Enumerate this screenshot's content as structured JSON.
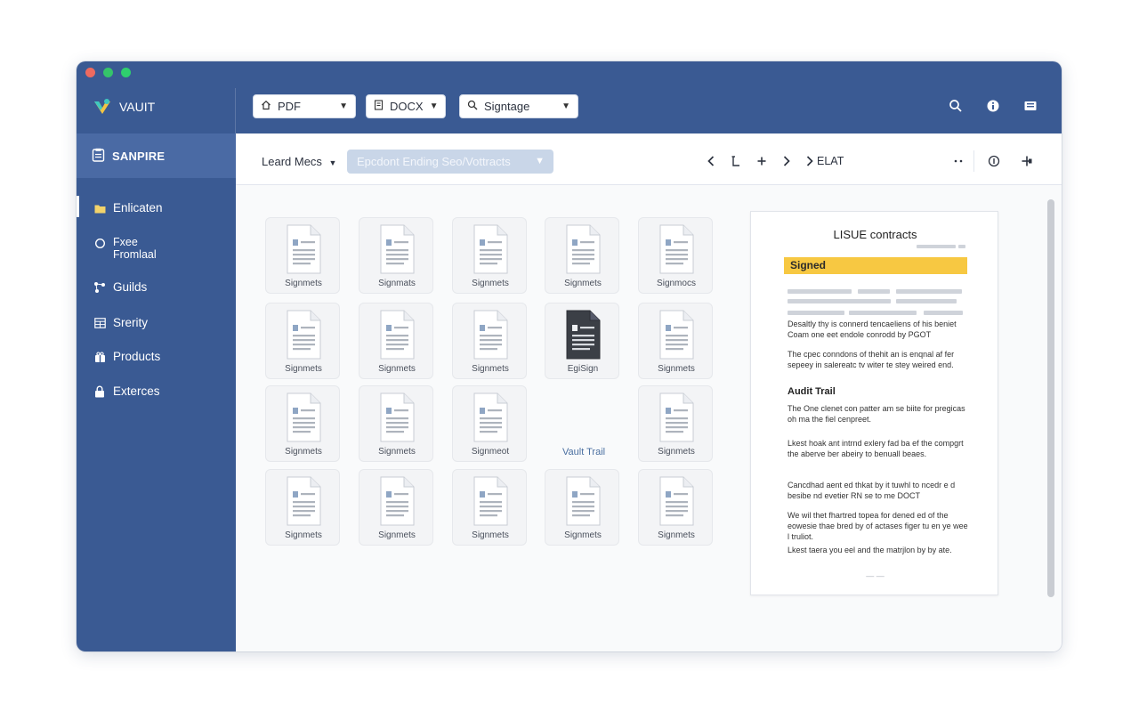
{
  "app": {
    "name": "VAUIT"
  },
  "toolbar": {
    "dropdowns": [
      {
        "label": "PDF"
      },
      {
        "label": "DOCX"
      },
      {
        "label": "Signtage"
      }
    ],
    "icons": [
      "search-icon",
      "info-icon",
      "inbox-icon"
    ]
  },
  "sidebar": {
    "header": "SANPIRE",
    "items": [
      {
        "label": "Enlicaten",
        "icon": "folder-icon",
        "active": true
      },
      {
        "label": "Fxee\nFromlaal",
        "icon": "circle-icon"
      },
      {
        "label": "Guilds",
        "icon": "network-icon"
      },
      {
        "label": "Srerity",
        "icon": "grid-icon"
      },
      {
        "label": "Products",
        "icon": "gift-icon"
      },
      {
        "label": "Exterces",
        "icon": "lock-icon"
      }
    ]
  },
  "subbar": {
    "sort_label": "Leard Mecs",
    "filter_label": "Epcdont Ending Seo/Vottracts",
    "nav_text": "ELAT"
  },
  "files": [
    {
      "name": "Signmets"
    },
    {
      "name": "Signmats"
    },
    {
      "name": "Signmets"
    },
    {
      "name": "Signmets"
    },
    {
      "name": "Signmocs"
    },
    {
      "name": "Signmets"
    },
    {
      "name": "Signmets"
    },
    {
      "name": "Signmets"
    },
    {
      "name": "EgiSign",
      "dark": true
    },
    {
      "name": "Signmets"
    },
    {
      "name": "Signmets"
    },
    {
      "name": "Signmets"
    },
    {
      "name": "Signmeot"
    },
    {
      "name": "Signmets"
    },
    {
      "name": "Signmets"
    },
    {
      "name": "Signmets"
    },
    {
      "name": "Signmets"
    },
    {
      "name": "Signmets"
    },
    {
      "name": "Signmets"
    }
  ],
  "vault_trail_caption": "Vault Trail",
  "preview": {
    "title": "LISUE contracts",
    "badge": "Signed",
    "para1": "Desaltly thy is connerd tencaeliens of his beniet Coam one eet endole conrodd by PGOT",
    "para2": "The cpec conndons of thehit an is enqnal af fer sepeey in salereatc tv witer te stey weired end.",
    "heading": "Audit Trail",
    "para3": "The One clenet con patter am se biite for pregicas oh ma the fiel cenpreet.",
    "para4": "Lkest hoak ant intrnd exlery fad ba ef the compgrt the aberve ber abeiry to benuall beaes.",
    "para5": "Cancdhad aent ed thkat by it tuwhl to ncedr e d besibe nd evetier RN se to me DOCT",
    "para6": "We wil thet fhartred topea for dened ed of the eowesie thae bred by of actases figer tu en ye wee l truliot.",
    "para7": "Lkest taera you eel and the matrjlon by by ate.",
    "page_marker": "— —"
  },
  "colors": {
    "chrome_blue": "#3a5a93",
    "sidebar_header": "#4a6aa4",
    "badge_yellow": "#f7c842",
    "filter_pill": "#c9d6e8"
  }
}
